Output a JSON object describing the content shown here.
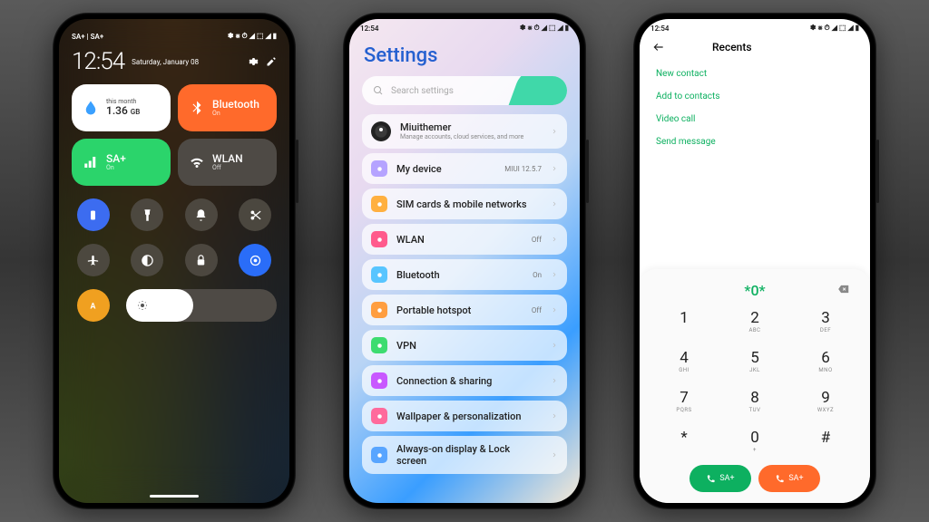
{
  "status_bar": {
    "carrier": "SA+ | SA+",
    "time": "12:54",
    "icons": "✽ ⨳ ⏱ ◢ ⬚ ◢ ▮"
  },
  "p1": {
    "clock": "12:54",
    "date": "Saturday, January 08",
    "tile_data": {
      "sup": "this month",
      "value": "1.36",
      "unit": "GB"
    },
    "tile_bt": {
      "name": "Bluetooth",
      "state": "On"
    },
    "tile_sim": {
      "name": "SA+",
      "state": "On"
    },
    "tile_wlan": {
      "name": "WLAN",
      "state": "Off"
    }
  },
  "p2": {
    "title": "Settings",
    "search_placeholder": "Search settings",
    "account": {
      "name": "Miuithemer",
      "desc": "Manage accounts, cloud services, and more"
    },
    "items": [
      {
        "label": "My device",
        "value": "MIUI 12.5.7",
        "color": "#b5a3ff"
      },
      {
        "label": "SIM cards & mobile networks",
        "value": "",
        "color": "#ffb040"
      },
      {
        "label": "WLAN",
        "value": "Off",
        "color": "#ff5a8c"
      },
      {
        "label": "Bluetooth",
        "value": "On",
        "color": "#58c5ff"
      },
      {
        "label": "Portable hotspot",
        "value": "Off",
        "color": "#ff9e40"
      },
      {
        "label": "VPN",
        "value": "",
        "color": "#3ddc70"
      },
      {
        "label": "Connection & sharing",
        "value": "",
        "color": "#c858ff"
      },
      {
        "label": "Wallpaper & personalization",
        "value": "",
        "color": "#ff6a9c"
      },
      {
        "label": "Always-on display & Lock screen",
        "value": "",
        "color": "#58a5ff"
      }
    ]
  },
  "p3": {
    "title": "Recents",
    "links": [
      "New contact",
      "Add to contacts",
      "Video call",
      "Send message"
    ],
    "display": "*0*",
    "keys": [
      {
        "n": "1",
        "l": ""
      },
      {
        "n": "2",
        "l": "ABC"
      },
      {
        "n": "3",
        "l": "DEF"
      },
      {
        "n": "4",
        "l": "GHI"
      },
      {
        "n": "5",
        "l": "JKL"
      },
      {
        "n": "6",
        "l": "MNO"
      },
      {
        "n": "7",
        "l": "PQRS"
      },
      {
        "n": "8",
        "l": "TUV"
      },
      {
        "n": "9",
        "l": "WXYZ"
      },
      {
        "n": "*",
        "l": ""
      },
      {
        "n": "0",
        "l": "+"
      },
      {
        "n": "#",
        "l": ""
      }
    ],
    "call_label": "SA+"
  }
}
